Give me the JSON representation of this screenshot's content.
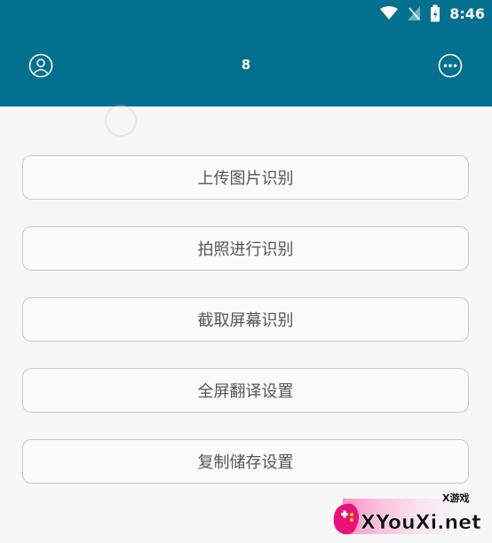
{
  "status_bar": {
    "time": "8:46"
  },
  "header": {
    "title": "8"
  },
  "buttons": [
    {
      "label": "上传图片识别"
    },
    {
      "label": "拍照进行识别"
    },
    {
      "label": "截取屏幕识别"
    },
    {
      "label": "全屏翻译设置"
    },
    {
      "label": "复制储存设置"
    }
  ],
  "watermark": {
    "brand": "XYouXi.net",
    "tag": "X游戏"
  },
  "colors": {
    "header": "#04708f",
    "background": "#f7f7f7",
    "button_border": "#c8c8c8",
    "button_text": "#555555"
  }
}
